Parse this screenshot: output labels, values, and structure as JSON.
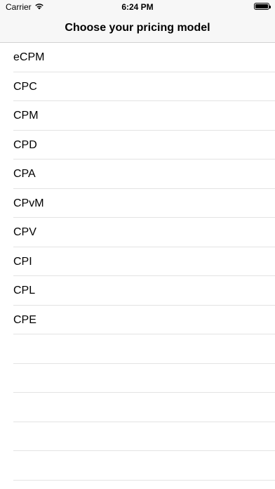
{
  "status_bar": {
    "carrier": "Carrier",
    "time": "6:24 PM",
    "wifi_icon": "wifi-icon",
    "battery_level": 1.0
  },
  "nav": {
    "title": "Choose your pricing model"
  },
  "pricing_models": [
    "eCPM",
    "CPC",
    "CPM",
    "CPD",
    "CPA",
    "CPvM",
    "CPV",
    "CPI",
    "CPL",
    "CPE"
  ],
  "empty_rows": 5,
  "colors": {
    "bar_background": "#f7f7f7",
    "separator": "#e3e3e3",
    "nav_border": "#d1d1d1"
  }
}
